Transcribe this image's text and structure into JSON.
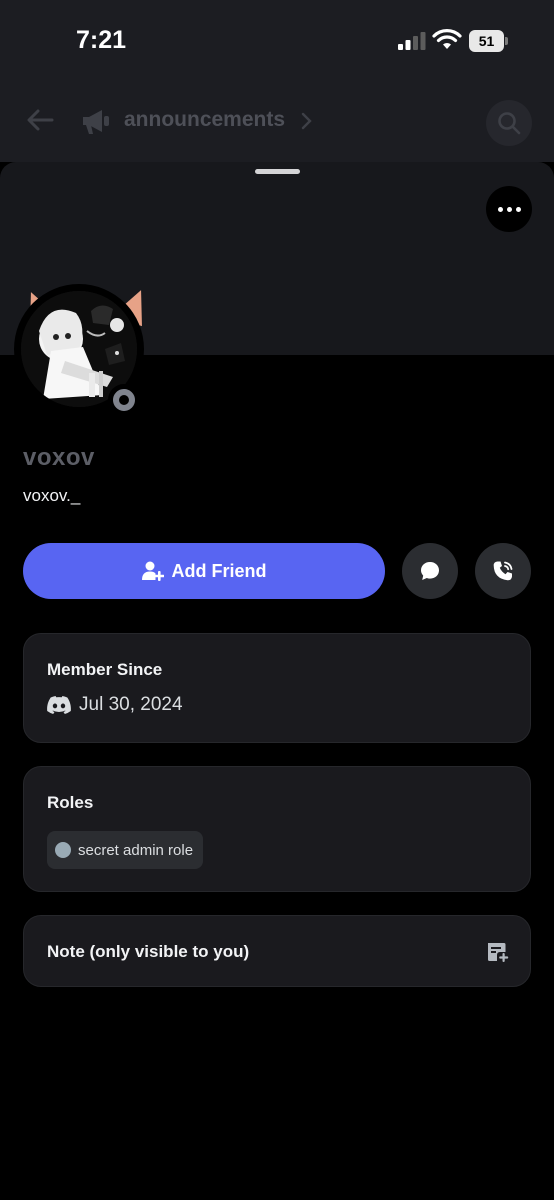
{
  "status_bar": {
    "time": "7:21",
    "battery_level": "51"
  },
  "channel_header": {
    "channel_name": "announcements"
  },
  "profile": {
    "display_name": "voxov",
    "username": "voxov._",
    "status": "offline"
  },
  "actions": {
    "add_friend_label": "Add Friend"
  },
  "member_since": {
    "title": "Member Since",
    "date": "Jul 30, 2024"
  },
  "roles": {
    "title": "Roles",
    "items": [
      {
        "name": "secret admin role",
        "color": "#99aab5"
      }
    ]
  },
  "note": {
    "title": "Note (only visible to you)"
  },
  "colors": {
    "accent": "#5865f2",
    "offline_status": "#80848e"
  }
}
